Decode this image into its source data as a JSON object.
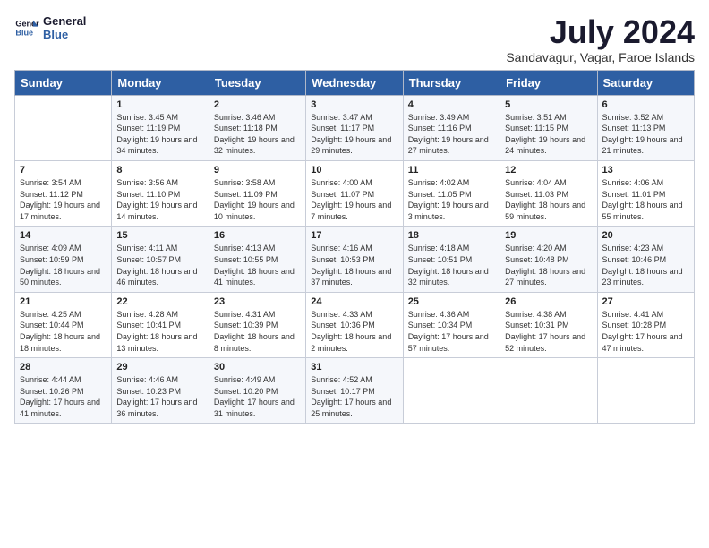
{
  "header": {
    "logo_line1": "General",
    "logo_line2": "Blue",
    "month": "July 2024",
    "location": "Sandavagur, Vagar, Faroe Islands"
  },
  "days_of_week": [
    "Sunday",
    "Monday",
    "Tuesday",
    "Wednesday",
    "Thursday",
    "Friday",
    "Saturday"
  ],
  "weeks": [
    [
      {
        "day": "",
        "empty": true
      },
      {
        "day": "1",
        "sunrise": "3:45 AM",
        "sunset": "11:19 PM",
        "daylight": "19 hours and 34 minutes."
      },
      {
        "day": "2",
        "sunrise": "3:46 AM",
        "sunset": "11:18 PM",
        "daylight": "19 hours and 32 minutes."
      },
      {
        "day": "3",
        "sunrise": "3:47 AM",
        "sunset": "11:17 PM",
        "daylight": "19 hours and 29 minutes."
      },
      {
        "day": "4",
        "sunrise": "3:49 AM",
        "sunset": "11:16 PM",
        "daylight": "19 hours and 27 minutes."
      },
      {
        "day": "5",
        "sunrise": "3:51 AM",
        "sunset": "11:15 PM",
        "daylight": "19 hours and 24 minutes."
      },
      {
        "day": "6",
        "sunrise": "3:52 AM",
        "sunset": "11:13 PM",
        "daylight": "19 hours and 21 minutes."
      }
    ],
    [
      {
        "day": "7",
        "sunrise": "3:54 AM",
        "sunset": "11:12 PM",
        "daylight": "19 hours and 17 minutes."
      },
      {
        "day": "8",
        "sunrise": "3:56 AM",
        "sunset": "11:10 PM",
        "daylight": "19 hours and 14 minutes."
      },
      {
        "day": "9",
        "sunrise": "3:58 AM",
        "sunset": "11:09 PM",
        "daylight": "19 hours and 10 minutes."
      },
      {
        "day": "10",
        "sunrise": "4:00 AM",
        "sunset": "11:07 PM",
        "daylight": "19 hours and 7 minutes."
      },
      {
        "day": "11",
        "sunrise": "4:02 AM",
        "sunset": "11:05 PM",
        "daylight": "19 hours and 3 minutes."
      },
      {
        "day": "12",
        "sunrise": "4:04 AM",
        "sunset": "11:03 PM",
        "daylight": "18 hours and 59 minutes."
      },
      {
        "day": "13",
        "sunrise": "4:06 AM",
        "sunset": "11:01 PM",
        "daylight": "18 hours and 55 minutes."
      }
    ],
    [
      {
        "day": "14",
        "sunrise": "4:09 AM",
        "sunset": "10:59 PM",
        "daylight": "18 hours and 50 minutes."
      },
      {
        "day": "15",
        "sunrise": "4:11 AM",
        "sunset": "10:57 PM",
        "daylight": "18 hours and 46 minutes."
      },
      {
        "day": "16",
        "sunrise": "4:13 AM",
        "sunset": "10:55 PM",
        "daylight": "18 hours and 41 minutes."
      },
      {
        "day": "17",
        "sunrise": "4:16 AM",
        "sunset": "10:53 PM",
        "daylight": "18 hours and 37 minutes."
      },
      {
        "day": "18",
        "sunrise": "4:18 AM",
        "sunset": "10:51 PM",
        "daylight": "18 hours and 32 minutes."
      },
      {
        "day": "19",
        "sunrise": "4:20 AM",
        "sunset": "10:48 PM",
        "daylight": "18 hours and 27 minutes."
      },
      {
        "day": "20",
        "sunrise": "4:23 AM",
        "sunset": "10:46 PM",
        "daylight": "18 hours and 23 minutes."
      }
    ],
    [
      {
        "day": "21",
        "sunrise": "4:25 AM",
        "sunset": "10:44 PM",
        "daylight": "18 hours and 18 minutes."
      },
      {
        "day": "22",
        "sunrise": "4:28 AM",
        "sunset": "10:41 PM",
        "daylight": "18 hours and 13 minutes."
      },
      {
        "day": "23",
        "sunrise": "4:31 AM",
        "sunset": "10:39 PM",
        "daylight": "18 hours and 8 minutes."
      },
      {
        "day": "24",
        "sunrise": "4:33 AM",
        "sunset": "10:36 PM",
        "daylight": "18 hours and 2 minutes."
      },
      {
        "day": "25",
        "sunrise": "4:36 AM",
        "sunset": "10:34 PM",
        "daylight": "17 hours and 57 minutes."
      },
      {
        "day": "26",
        "sunrise": "4:38 AM",
        "sunset": "10:31 PM",
        "daylight": "17 hours and 52 minutes."
      },
      {
        "day": "27",
        "sunrise": "4:41 AM",
        "sunset": "10:28 PM",
        "daylight": "17 hours and 47 minutes."
      }
    ],
    [
      {
        "day": "28",
        "sunrise": "4:44 AM",
        "sunset": "10:26 PM",
        "daylight": "17 hours and 41 minutes."
      },
      {
        "day": "29",
        "sunrise": "4:46 AM",
        "sunset": "10:23 PM",
        "daylight": "17 hours and 36 minutes."
      },
      {
        "day": "30",
        "sunrise": "4:49 AM",
        "sunset": "10:20 PM",
        "daylight": "17 hours and 31 minutes."
      },
      {
        "day": "31",
        "sunrise": "4:52 AM",
        "sunset": "10:17 PM",
        "daylight": "17 hours and 25 minutes."
      },
      {
        "day": "",
        "empty": true
      },
      {
        "day": "",
        "empty": true
      },
      {
        "day": "",
        "empty": true
      }
    ]
  ]
}
